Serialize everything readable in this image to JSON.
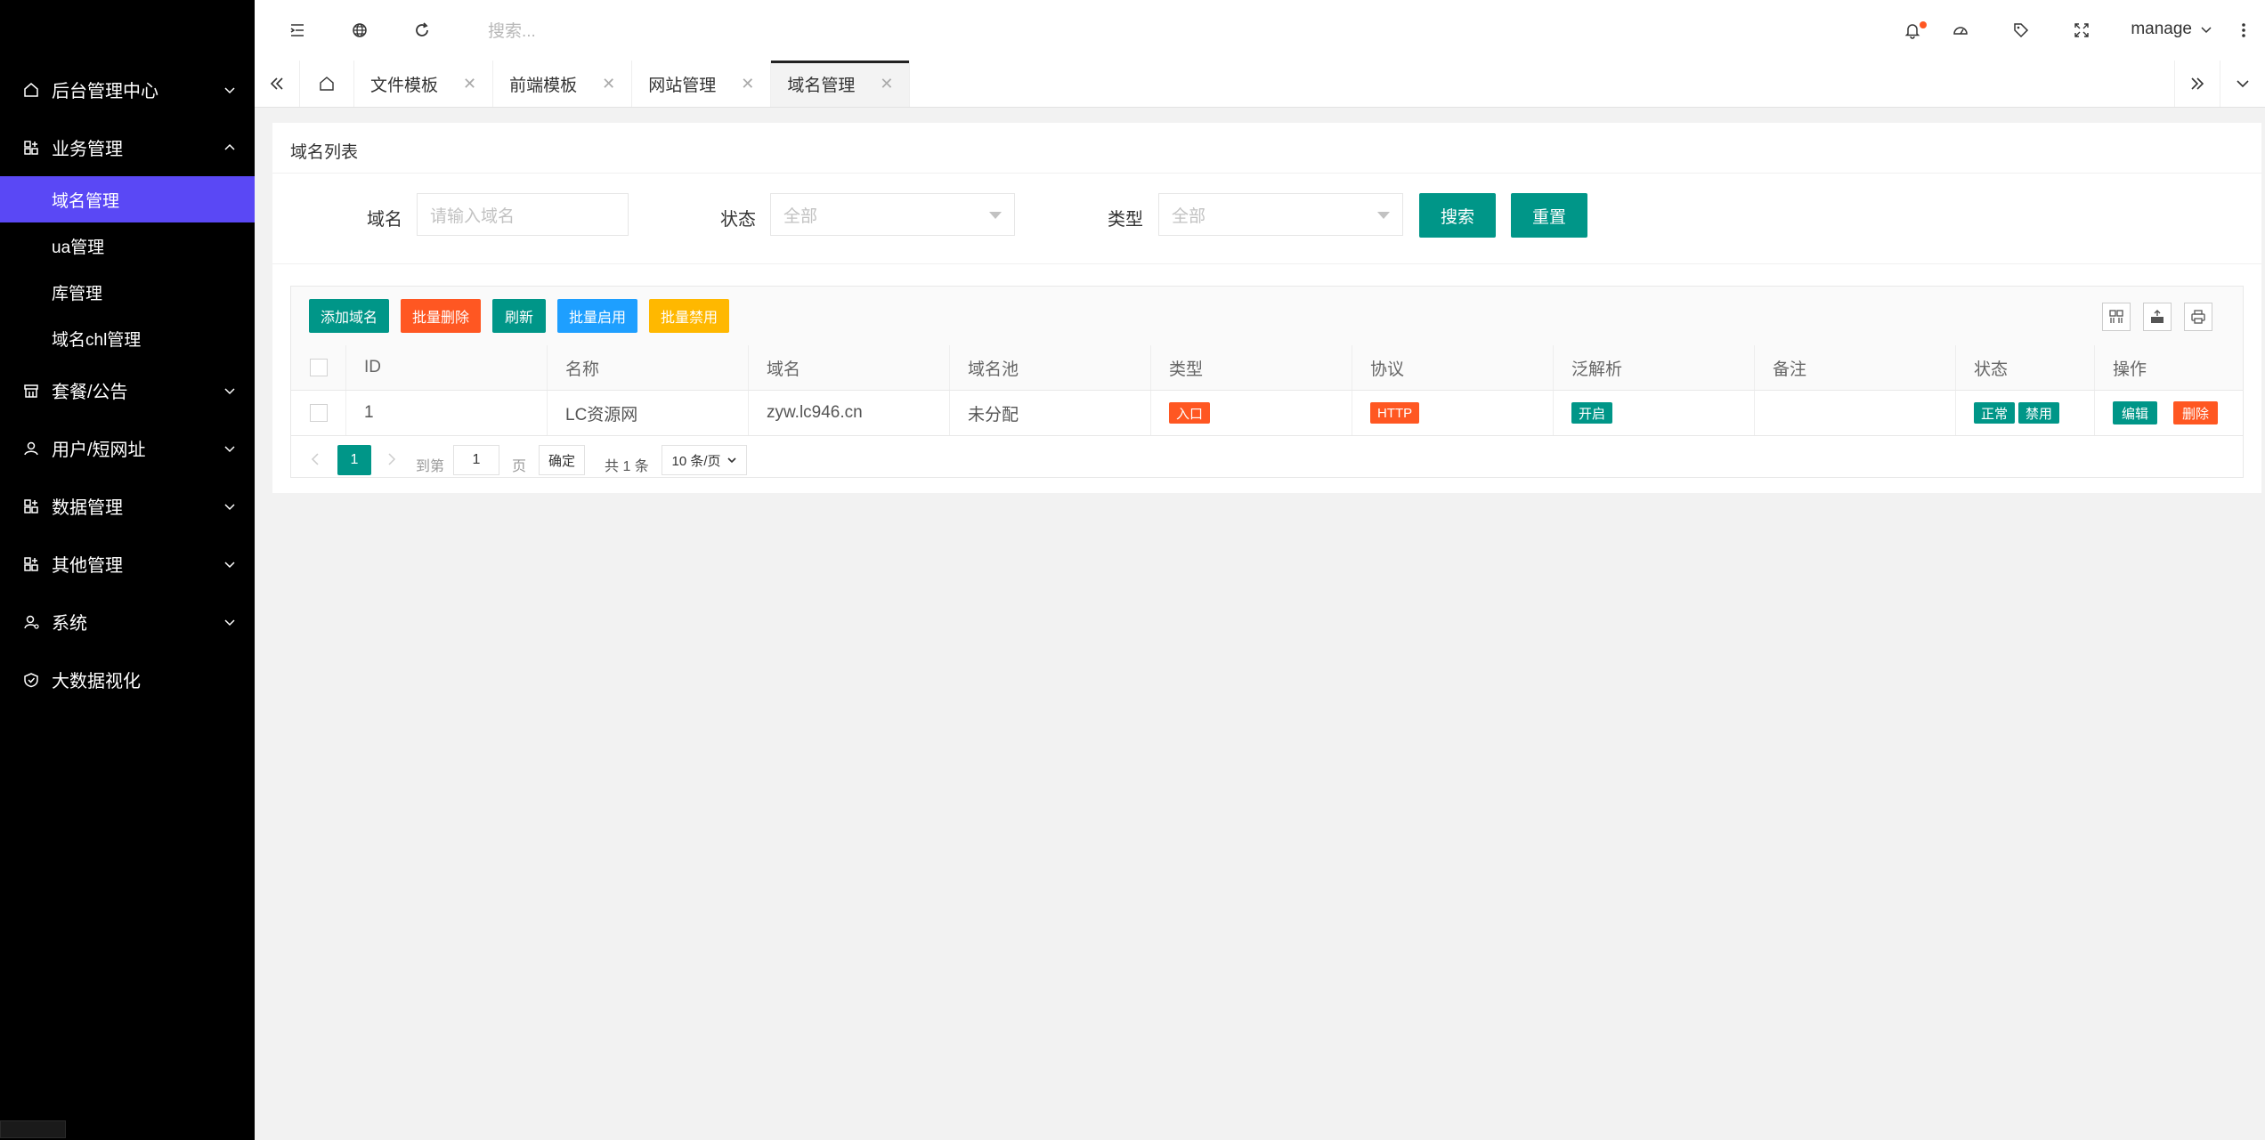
{
  "sidebar": {
    "menu": [
      {
        "label": "后台管理中心",
        "icon": "home-icon",
        "expanded": false
      },
      {
        "label": "业务管理",
        "icon": "app-grid-icon",
        "expanded": true,
        "children": [
          {
            "label": "域名管理",
            "active": true
          },
          {
            "label": "ua管理",
            "active": false
          },
          {
            "label": "库管理",
            "active": false
          },
          {
            "label": "域名chl管理",
            "active": false
          }
        ]
      },
      {
        "label": "套餐/公告",
        "icon": "store-icon",
        "expanded": false
      },
      {
        "label": "用户/短网址",
        "icon": "user-icon",
        "expanded": false
      },
      {
        "label": "数据管理",
        "icon": "app-grid-icon",
        "expanded": false
      },
      {
        "label": "其他管理",
        "icon": "app-grid-icon",
        "expanded": false
      },
      {
        "label": "系统",
        "icon": "user-cog-icon",
        "expanded": false
      },
      {
        "label": "大数据视化",
        "icon": "shield-check-icon",
        "expanded": false
      }
    ],
    "active_color": "#5a48f5"
  },
  "topbar": {
    "search_placeholder": "搜索...",
    "user": "manage"
  },
  "tabs": {
    "items": [
      {
        "label": "文件模板",
        "active": false
      },
      {
        "label": "前端模板",
        "active": false
      },
      {
        "label": "网站管理",
        "active": false
      },
      {
        "label": "域名管理",
        "active": true
      }
    ]
  },
  "panel": {
    "title": "域名列表",
    "filters": {
      "domain_label": "域名",
      "domain_placeholder": "请输入域名",
      "status_label": "状态",
      "status_value": "全部",
      "type_label": "类型",
      "type_value": "全部",
      "search_btn": "搜索",
      "reset_btn": "重置"
    },
    "toolbar": {
      "add": "添加域名",
      "batch_delete": "批量删除",
      "refresh": "刷新",
      "batch_enable": "批量启用",
      "batch_disable": "批量禁用"
    },
    "table": {
      "headers": [
        "ID",
        "名称",
        "域名",
        "域名池",
        "类型",
        "协议",
        "泛解析",
        "备注",
        "状态",
        "操作"
      ],
      "rows": [
        {
          "id": "1",
          "name": "LC资源网",
          "domain": "zyw.lc946.cn",
          "pool": "未分配",
          "type": "入口",
          "protocol": "HTTP",
          "wildcard": "开启",
          "remark": "",
          "status_ok": "正常",
          "status_disable": "禁用",
          "edit": "编辑",
          "delete": "删除"
        }
      ]
    },
    "pager": {
      "current": "1",
      "goto_label": "到第",
      "goto_value": "1",
      "page_label": "页",
      "confirm": "确定",
      "total": "共 1 条",
      "per_page": "10 条/页"
    }
  },
  "colors": {
    "primary": "#009688",
    "danger": "#ff5722",
    "info": "#1e9fff",
    "warning": "#ffb800"
  }
}
